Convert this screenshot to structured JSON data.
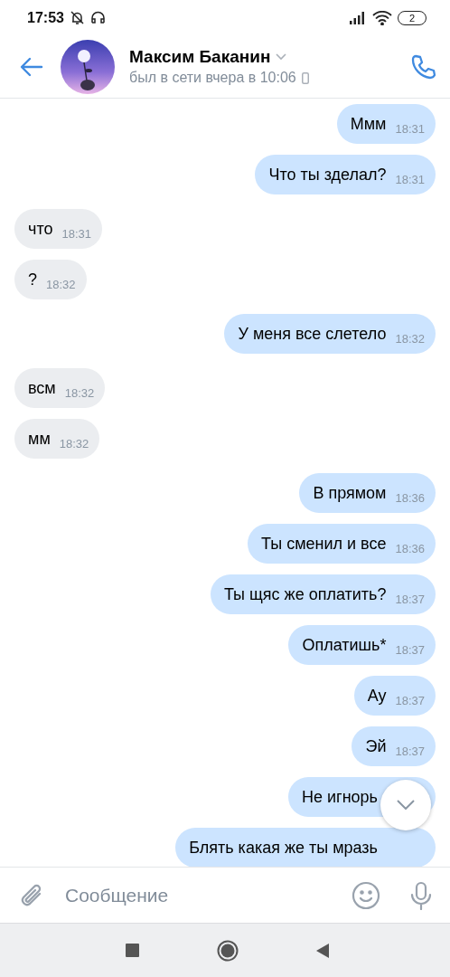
{
  "status_bar": {
    "time": "17:53",
    "battery": "2"
  },
  "header": {
    "name": "Максим Баканин",
    "status": "был в сети вчера в 10:06"
  },
  "messages": [
    {
      "kind": "out",
      "text": "Ммм",
      "time": "18:31"
    },
    {
      "kind": "out",
      "text": "Что ты зделал?",
      "time": "18:31"
    },
    {
      "kind": "in",
      "text": "что",
      "time": "18:31"
    },
    {
      "kind": "in",
      "text": "?",
      "time": "18:32"
    },
    {
      "kind": "out",
      "text": "У меня все слетело",
      "time": "18:32"
    },
    {
      "kind": "in",
      "text": "всм",
      "time": "18:32"
    },
    {
      "kind": "in",
      "text": "мм",
      "time": "18:32"
    },
    {
      "kind": "out",
      "text": "В прямом",
      "time": "18:36"
    },
    {
      "kind": "out",
      "text": "Ты сменил и все",
      "time": "18:36"
    },
    {
      "kind": "out",
      "text": "Ты щяс же оплатить?",
      "time": "18:37"
    },
    {
      "kind": "out",
      "text": "Оплатишь*",
      "time": "18:37"
    },
    {
      "kind": "out",
      "text": "Ау",
      "time": "18:37"
    },
    {
      "kind": "out",
      "text": "Эй",
      "time": "18:37"
    },
    {
      "kind": "out",
      "text": "Не игнорь"
    },
    {
      "kind": "out",
      "text": "Блять какая же ты мразь"
    }
  ],
  "composer": {
    "placeholder": "Сообщение"
  }
}
